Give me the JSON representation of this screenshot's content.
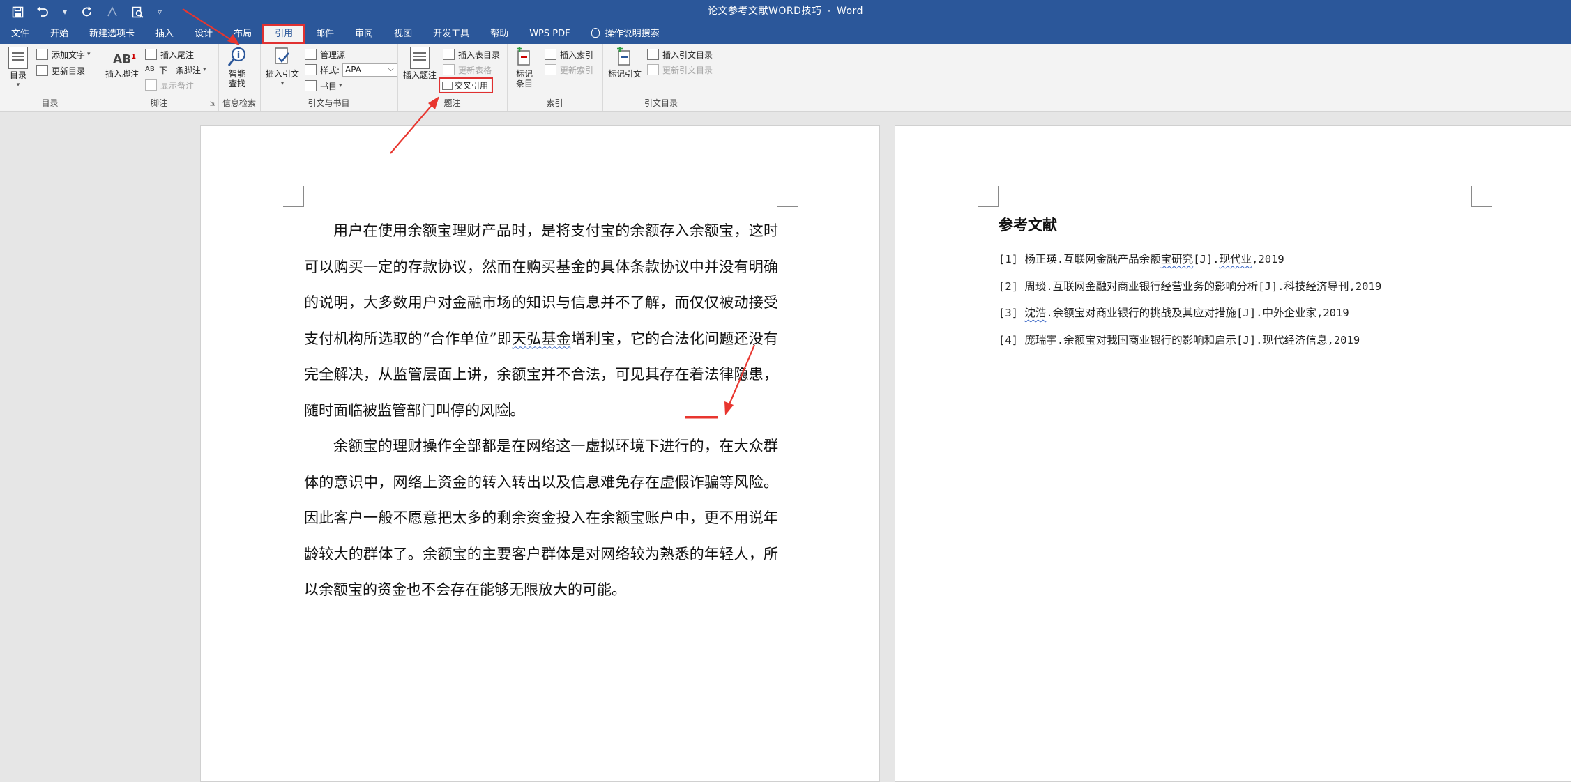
{
  "window": {
    "title_doc": "论文参考文献WORD技巧",
    "title_sep": "-",
    "title_app": "Word"
  },
  "tabs": [
    "文件",
    "开始",
    "新建选项卡",
    "插入",
    "设计",
    "布局",
    "引用",
    "邮件",
    "审阅",
    "视图",
    "开发工具",
    "帮助",
    "WPS PDF",
    "操作说明搜索"
  ],
  "ribbon": {
    "toc": {
      "big": "目录",
      "add_text": "添加文字",
      "update": "更新目录",
      "label": "目录"
    },
    "footnote": {
      "big": "插入脚注",
      "insert_endnote": "插入尾注",
      "next_footnote": "下一条脚注",
      "show_notes": "显示备注",
      "label": "脚注"
    },
    "research": {
      "big_1": "智能",
      "big_2": "查找",
      "label": "信息检索"
    },
    "citation": {
      "big": "插入引文",
      "manage": "管理源",
      "style_label": "样式:",
      "style_value": "APA",
      "bibliography": "书目",
      "label": "引文与书目"
    },
    "caption": {
      "big": "插入题注",
      "insert_tof": "插入表目录",
      "update_table": "更新表格",
      "cross_ref": "交叉引用",
      "label": "题注"
    },
    "index": {
      "big_1": "标记",
      "big_2": "条目",
      "insert_index": "插入索引",
      "update_index": "更新索引",
      "label": "索引"
    },
    "toa": {
      "big": "标记引文",
      "insert_toa": "插入引文目录",
      "update_toa": "更新引文目录",
      "label": "引文目录"
    }
  },
  "document": {
    "p1": {
      "a": "用户在使用余额宝理财产品时，是将支付宝的余额存入余额宝，这时可以购买一定的存款协议，然而在购买基金的具体条款协议中并没有明确的说明，大多数用户对金融市场的知识与信息并不了解，而仅仅被动接受支付机构所选取的“合作单位”即",
      "b": "天弘基金",
      "c": "增利宝，它的合法化问题还没有完全解决，从监管层面上讲，余额宝并不合法，可见其存在着法律隐患，随时面临被监管部门叫停的风险",
      "d": "。"
    },
    "p2": "余额宝的理财操作全部都是在网络这一虚拟环境下进行的，在大众群体的意识中，网络上资金的转入转出以及信息难免存在虚假诈骗等风险。因此客户一般不愿意把太多的剩余资金投入在余额宝账户中，更不用说年龄较大的群体了。余额宝的主要客户群体是对网络较为熟悉的年轻人，所以余额宝的资金也不会存在能够无限放大的可能。",
    "references_heading": "参考文献",
    "references": [
      {
        "a": "[1] 杨正瑛.互联网金融产品余额",
        "b": "宝研究",
        "c": "[J].",
        "d": "现代业",
        "e": ",2019"
      },
      {
        "a": "[2] 周琰.互联网金融对商业银行经营业务的影响分析[J].科技经济导刊,2019"
      },
      {
        "a": "[3] ",
        "b": "沈浩",
        "c": ".余额宝对商业银行的挑战及其应对措施[J].中外企业家,2019"
      },
      {
        "a": "[4] 庞瑞宇.余额宝对我国商业银行的影响和启示[J].现代经济信息,2019"
      }
    ]
  }
}
